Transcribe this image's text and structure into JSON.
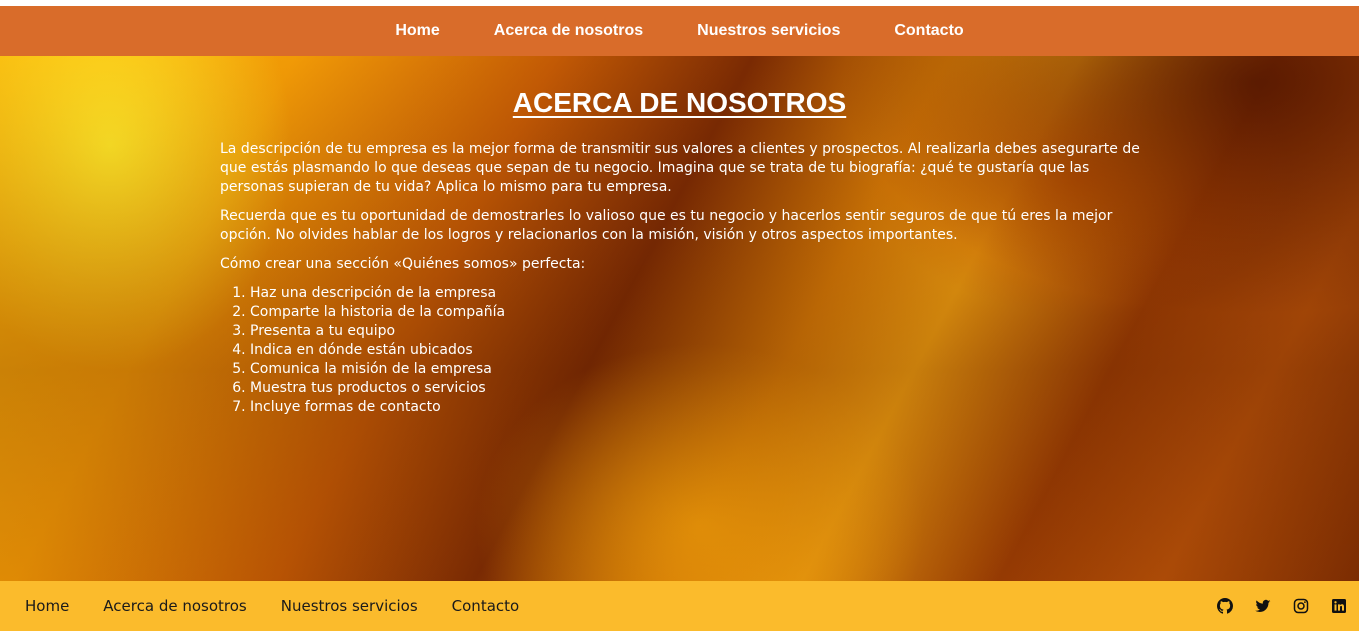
{
  "top_nav": {
    "items": [
      "Home",
      "Acerca de nosotros",
      "Nuestros servicios",
      "Contacto"
    ]
  },
  "main": {
    "title": "ACERCA DE NOSOTROS",
    "paragraphs": [
      "La descripción de tu empresa es la mejor forma de transmitir sus valores a clientes y prospectos. Al realizarla debes asegurarte de que estás plasmando lo que deseas que sepan de tu negocio. Imagina que se trata de tu biografía: ¿qué te gustaría que las personas supieran de tu vida? Aplica lo mismo para tu empresa.",
      "Recuerda que es tu oportunidad de demostrarles lo valioso que es tu negocio y hacerlos sentir seguros de que tú eres la mejor opción. No olvides hablar de los logros y relacionarlos con la misión, visión y otros aspectos importantes.",
      "Cómo crear una sección «Quiénes somos» perfecta:"
    ],
    "steps": [
      "Haz una descripción de la empresa",
      "Comparte la historia de la compañía",
      "Presenta a tu equipo",
      "Indica en dónde están ubicados",
      "Comunica la misión de la empresa",
      "Muestra tus productos o servicios",
      "Incluye formas de contacto"
    ]
  },
  "footer": {
    "links": [
      "Home",
      "Acerca de nosotros",
      "Nuestros servicios",
      "Contacto"
    ],
    "social_icons": [
      "github-icon",
      "twitter-icon",
      "instagram-icon",
      "linkedin-icon"
    ]
  },
  "colors": {
    "top_nav_bg": "#d96c2a",
    "footer_bg": "#fbbb2c",
    "text_light": "#ffffff",
    "text_dark": "#1a1a1a"
  }
}
